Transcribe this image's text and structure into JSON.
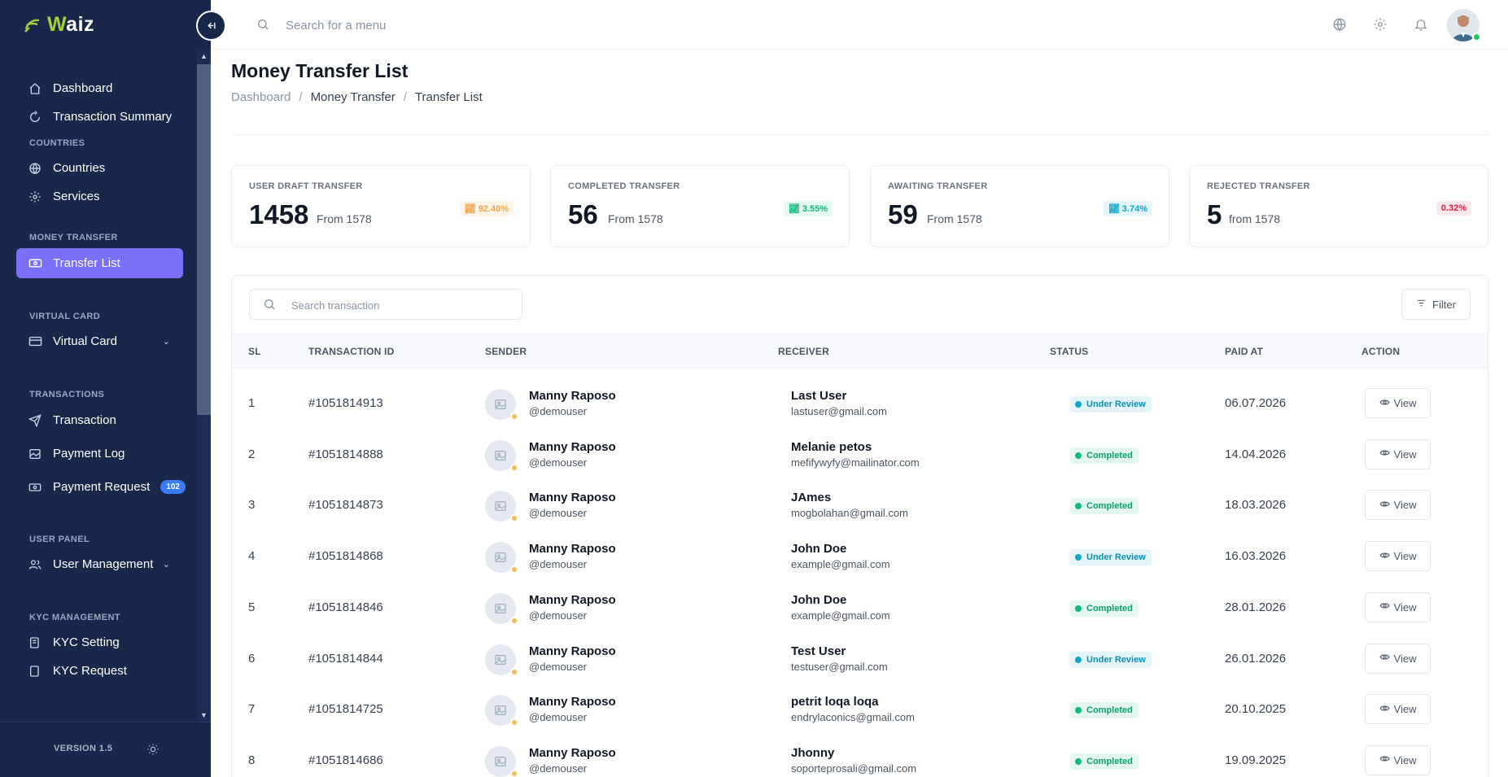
{
  "brand": {
    "name_part1": "W",
    "name_part2": "aiz"
  },
  "sidebar": {
    "items": [
      {
        "label": "Dashboard"
      },
      {
        "label": "Transaction Summary"
      }
    ],
    "sections": [
      {
        "title": "COUNTRIES",
        "items": [
          {
            "label": "Countries"
          },
          {
            "label": "Services"
          }
        ]
      },
      {
        "title": "MONEY TRANSFER",
        "items": [
          {
            "label": "Transfer List",
            "active": true
          }
        ]
      },
      {
        "title": "VIRTUAL CARD",
        "items": [
          {
            "label": "Virtual Card"
          }
        ]
      },
      {
        "title": "TRANSACTIONS",
        "items": [
          {
            "label": "Transaction"
          },
          {
            "label": "Payment Log"
          },
          {
            "label": "Payment Request",
            "badge": "102"
          }
        ]
      },
      {
        "title": "USER PANEL",
        "items": [
          {
            "label": "User Management"
          }
        ]
      },
      {
        "title": "KYC MANAGEMENT",
        "items": [
          {
            "label": "KYC Setting"
          },
          {
            "label": "KYC Request"
          }
        ]
      }
    ],
    "version": "VERSION 1.5"
  },
  "header": {
    "search_placeholder": "Search for a menu",
    "icons": [
      "globe-icon",
      "gear-icon",
      "bell-icon"
    ]
  },
  "page": {
    "title": "Money Transfer List",
    "breadcrumb": [
      "Dashboard",
      "Money Transfer",
      "Transfer List"
    ],
    "separator": "/"
  },
  "stats": [
    {
      "label": "USER DRAFT TRANSFER",
      "value": "1458",
      "from": "From 1578",
      "change": "92.40%",
      "color": "#f0a54a"
    },
    {
      "label": "COMPLETED TRANSFER",
      "value": "56",
      "from": "From 1578",
      "change": "3.55%",
      "color": "#10b981"
    },
    {
      "label": "AWAITING TRANSFER",
      "value": "59",
      "from": "From 1578",
      "change": "3.74%",
      "color": "#0ea5c6"
    },
    {
      "label": "REJECTED TRANSFER",
      "value": "5",
      "from": "from 1578",
      "change": "0.32%",
      "color": "#e11d48"
    }
  ],
  "table": {
    "search_placeholder": "Search transaction",
    "filter_label": "Filter",
    "columns": [
      "SL",
      "TRANSACTION ID",
      "SENDER",
      "RECEIVER",
      "STATUS",
      "PAID AT",
      "ACTION"
    ],
    "view_label": "View",
    "rows": [
      {
        "sl": "1",
        "id": "#1051814913",
        "sender": "Manny Raposo",
        "sender_user": "@demouser",
        "receiver": "Last User",
        "receiver_email": "lastuser@gmail.com",
        "status": "Under Review",
        "paid_at": "06.07.2026"
      },
      {
        "sl": "2",
        "id": "#1051814888",
        "sender": "Manny Raposo",
        "sender_user": "@demouser",
        "receiver": "Melanie petos",
        "receiver_email": "mefifywyfy@mailinator.com",
        "status": "Completed",
        "paid_at": "14.04.2026"
      },
      {
        "sl": "3",
        "id": "#1051814873",
        "sender": "Manny Raposo",
        "sender_user": "@demouser",
        "receiver": "JAmes",
        "receiver_email": "mogbolahan@gmail.com",
        "status": "Completed",
        "paid_at": "18.03.2026"
      },
      {
        "sl": "4",
        "id": "#1051814868",
        "sender": "Manny Raposo",
        "sender_user": "@demouser",
        "receiver": "John Doe",
        "receiver_email": "example@gmail.com",
        "status": "Under Review",
        "paid_at": "16.03.2026"
      },
      {
        "sl": "5",
        "id": "#1051814846",
        "sender": "Manny Raposo",
        "sender_user": "@demouser",
        "receiver": "John Doe",
        "receiver_email": "example@gmail.com",
        "status": "Completed",
        "paid_at": "28.01.2026"
      },
      {
        "sl": "6",
        "id": "#1051814844",
        "sender": "Manny Raposo",
        "sender_user": "@demouser",
        "receiver": "Test User",
        "receiver_email": "testuser@gmail.com",
        "status": "Under Review",
        "paid_at": "26.01.2026"
      },
      {
        "sl": "7",
        "id": "#1051814725",
        "sender": "Manny Raposo",
        "sender_user": "@demouser",
        "receiver": "petrit loqa loqa",
        "receiver_email": "endrylaconics@gmail.com",
        "status": "Completed",
        "paid_at": "20.10.2025"
      },
      {
        "sl": "8",
        "id": "#1051814686",
        "sender": "Manny Raposo",
        "sender_user": "@demouser",
        "receiver": "Jhonny",
        "receiver_email": "soporteprosali@gmail.com",
        "status": "Completed",
        "paid_at": "19.09.2025"
      }
    ]
  },
  "colors": {
    "sidebar_bg": "#18274a",
    "active_nav": "#7b6ff7",
    "brand_accent": "#a3d13a",
    "badge_blue": "#3b7bf6"
  }
}
